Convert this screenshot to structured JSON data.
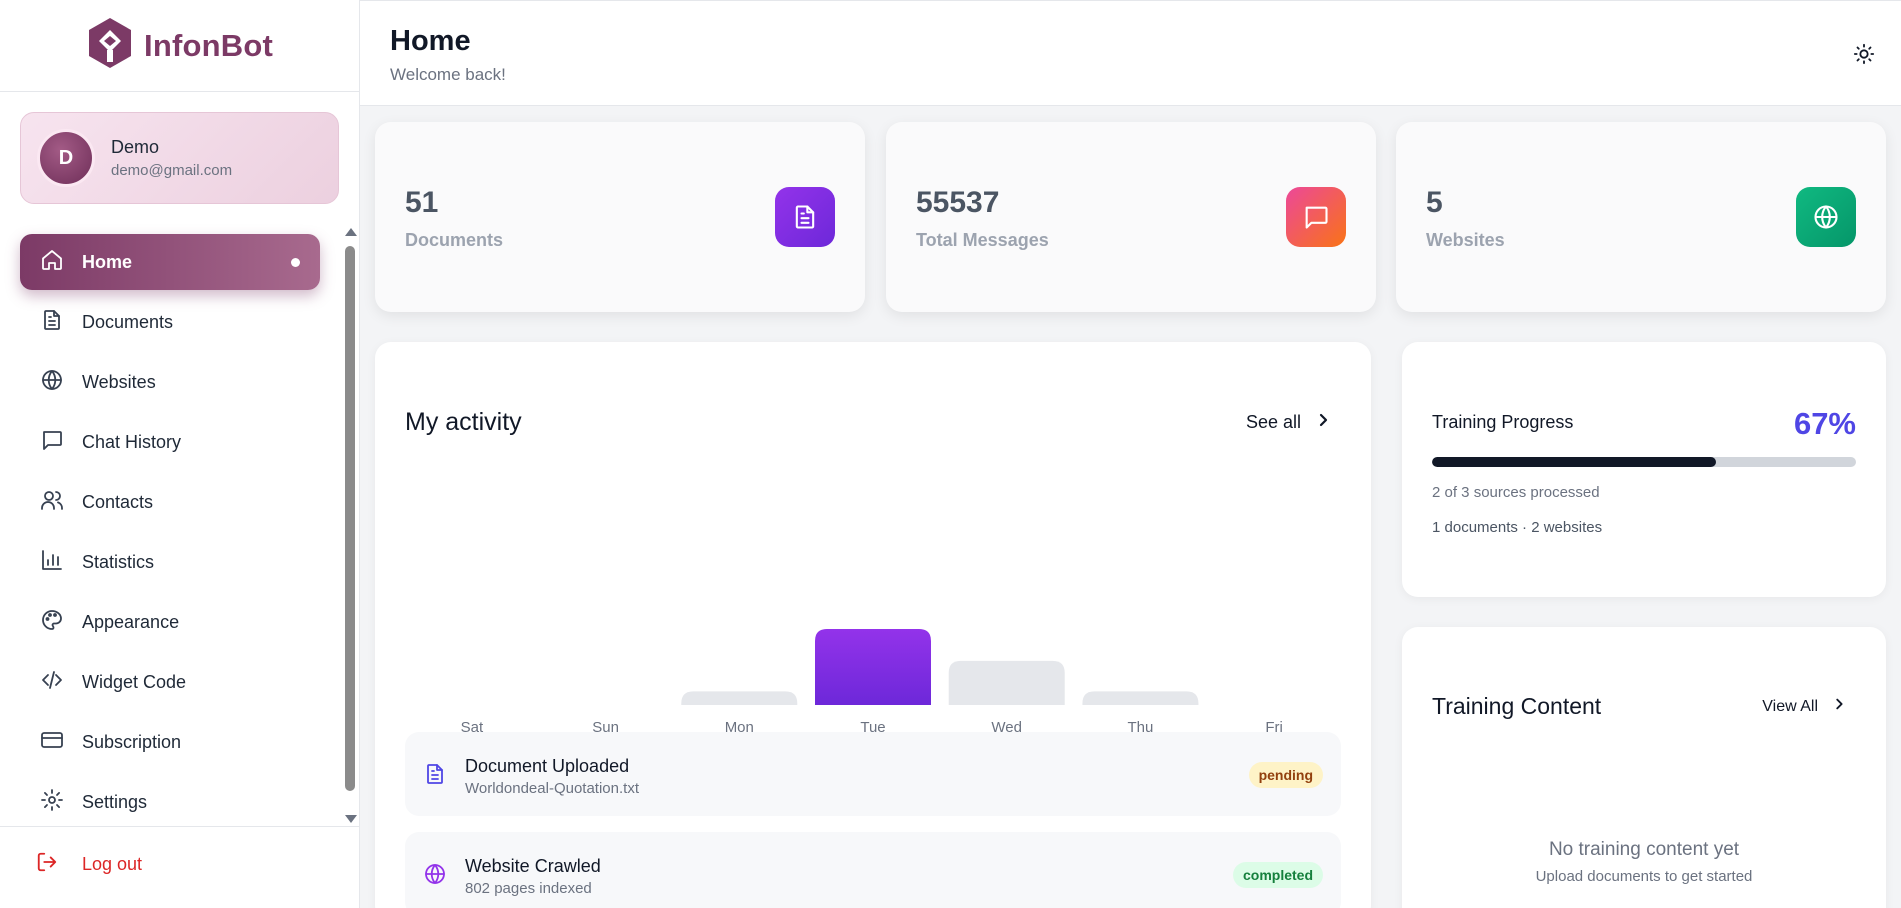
{
  "brand": {
    "name": "InfonBot",
    "color": "#7c3a66"
  },
  "user": {
    "initial": "D",
    "name": "Demo",
    "email": "demo@gmail.com"
  },
  "nav": {
    "items": [
      {
        "label": "Home",
        "icon": "home-icon",
        "active": true
      },
      {
        "label": "Documents",
        "icon": "document-icon"
      },
      {
        "label": "Websites",
        "icon": "globe-icon"
      },
      {
        "label": "Chat History",
        "icon": "chat-icon"
      },
      {
        "label": "Contacts",
        "icon": "users-icon"
      },
      {
        "label": "Statistics",
        "icon": "bar-chart-icon"
      },
      {
        "label": "Appearance",
        "icon": "palette-icon"
      },
      {
        "label": "Widget Code",
        "icon": "code-icon"
      },
      {
        "label": "Subscription",
        "icon": "credit-card-icon"
      },
      {
        "label": "Settings",
        "icon": "gear-icon"
      }
    ],
    "logout": "Log out"
  },
  "header": {
    "title": "Home",
    "subtitle": "Welcome back!",
    "theme_icon": "sun-icon"
  },
  "stats": [
    {
      "value": "51",
      "label": "Documents",
      "icon": "document-icon",
      "colors": [
        "#9333ea",
        "#6d28d9"
      ]
    },
    {
      "value": "55537",
      "label": "Total Messages",
      "icon": "chat-icon",
      "colors": [
        "#ec4899",
        "#f97316"
      ]
    },
    {
      "value": "5",
      "label": "Websites",
      "icon": "globe-icon",
      "colors": [
        "#10b981",
        "#059669"
      ]
    }
  ],
  "activity": {
    "title": "My activity",
    "see_all": "See all",
    "items": [
      {
        "title": "Document Uploaded",
        "subtitle": "Worldondeal-Quotation.txt",
        "status": "pending",
        "icon": "document-icon"
      },
      {
        "title": "Website Crawled",
        "subtitle": "802 pages indexed",
        "status": "completed",
        "icon": "globe-icon"
      }
    ]
  },
  "chart_data": {
    "type": "bar",
    "categories": [
      "Sat",
      "Sun",
      "Mon",
      "Tue",
      "Wed",
      "Thu",
      "Fri"
    ],
    "values": [
      0,
      0,
      0.18,
      1.0,
      0.58,
      0.18,
      0
    ],
    "highlight_index": 3,
    "colors": {
      "highlight": [
        "#9333ea",
        "#6d28d9"
      ],
      "default": "#e5e7eb"
    }
  },
  "training": {
    "title": "Training Progress",
    "percent_label": "67%",
    "percent": 67,
    "sources_text": "2 of 3 sources processed",
    "breakdown_text": "1 documents · 2 websites"
  },
  "content": {
    "title": "Training Content",
    "view_all": "View All",
    "empty_title": "No training content yet",
    "empty_subtitle": "Upload documents to get started"
  }
}
